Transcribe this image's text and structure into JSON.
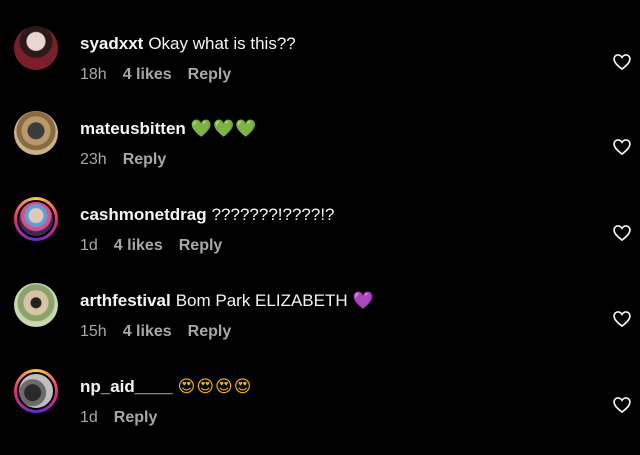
{
  "comments": [
    {
      "username": "syadxxt",
      "text": "Okay what is this??",
      "emoji": "",
      "time": "18h",
      "likes": "4 likes",
      "reply": "Reply"
    },
    {
      "username": "mateusbitten",
      "text": "",
      "emoji": "💚💚💚",
      "time": "23h",
      "likes": "",
      "reply": "Reply"
    },
    {
      "username": "cashmonetdrag",
      "text": "???????!????!?",
      "emoji": "",
      "time": "1d",
      "likes": "4 likes",
      "reply": "Reply"
    },
    {
      "username": "arthfestival",
      "text": "Bom Park ELIZABETH",
      "emoji": "💜",
      "time": "15h",
      "likes": "4 likes",
      "reply": "Reply"
    },
    {
      "username": "np_aid____",
      "text": "",
      "emoji": "😍😍😍😍",
      "time": "1d",
      "likes": "",
      "reply": "Reply"
    }
  ],
  "icons": {
    "like": "heart-outline-icon"
  },
  "colors": {
    "background": "#000000",
    "primary_text": "#f5f5f5",
    "secondary_text": "#a8a8a8"
  }
}
